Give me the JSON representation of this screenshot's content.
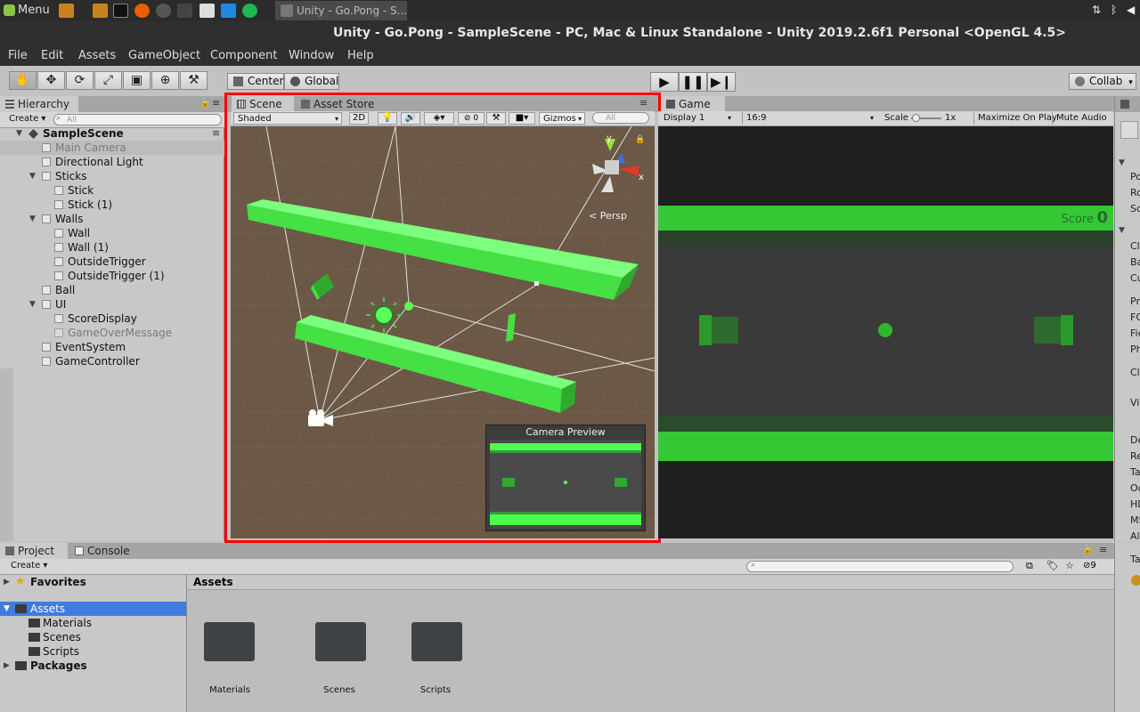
{
  "taskbar": {
    "menu_label": "Menu",
    "task_title": "Unity - Go.Pong - S..."
  },
  "window": {
    "title": "Unity - Go.Pong - SampleScene - PC, Mac & Linux Standalone - Unity 2019.2.6f1 Personal <OpenGL 4.5>"
  },
  "menubar": {
    "items": [
      "File",
      "Edit",
      "Assets",
      "GameObject",
      "Component",
      "Window",
      "Help"
    ]
  },
  "toolbar": {
    "pivot_label": "Center",
    "space_label": "Global",
    "collab_label": "Collab"
  },
  "hierarchy": {
    "tab_label": "Hierarchy",
    "create_label": "Create",
    "search_placeholder": "All",
    "scene_name": "SampleScene",
    "items": [
      {
        "label": "Main Camera"
      },
      {
        "label": "Directional Light"
      },
      {
        "label": "Sticks"
      },
      {
        "label": "Stick"
      },
      {
        "label": "Stick (1)"
      },
      {
        "label": "Walls"
      },
      {
        "label": "Wall"
      },
      {
        "label": "Wall (1)"
      },
      {
        "label": "OutsideTrigger"
      },
      {
        "label": "OutsideTrigger (1)"
      },
      {
        "label": "Ball"
      },
      {
        "label": "UI"
      },
      {
        "label": "ScoreDisplay"
      },
      {
        "label": "GameOverMessage"
      },
      {
        "label": "EventSystem"
      },
      {
        "label": "GameController"
      }
    ]
  },
  "scene": {
    "tab_label": "Scene",
    "store_tab_label": "Asset Store",
    "shading_mode": "Shaded",
    "mode_2d": "2D",
    "hidden_count": "0",
    "gizmos_label": "Gizmos",
    "search_placeholder": "All",
    "persp_label": "Persp",
    "axis_y": "y",
    "axis_x": "x",
    "camera_preview_title": "Camera Preview"
  },
  "game": {
    "tab_label": "Game",
    "display_label": "Display 1",
    "aspect_label": "16:9",
    "scale_label": "Scale",
    "scale_value": "1x",
    "maximize_label": "Maximize On Play",
    "mute_label": "Mute Audio",
    "score_label": "Score",
    "score_value": "0"
  },
  "inspector": {
    "partial_labels": [
      "Po",
      "Ro",
      "Sc",
      "Cl",
      "Ba",
      "Cu",
      "Pr",
      "FO",
      "Fie",
      "Ph",
      "Cl",
      "Vie",
      "De",
      "Re",
      "Ta",
      "Oc",
      "HD",
      "MS",
      "Al",
      "Ta"
    ]
  },
  "project": {
    "tab_label": "Project",
    "console_tab_label": "Console",
    "create_label": "Create",
    "hidden_count": "9",
    "favorites_label": "Favorites",
    "assets_label": "Assets",
    "tree": [
      {
        "label": "Materials"
      },
      {
        "label": "Scenes"
      },
      {
        "label": "Scripts"
      }
    ],
    "packages_label": "Packages",
    "breadcrumb": "Assets",
    "folders": [
      {
        "label": "Materials"
      },
      {
        "label": "Scenes"
      },
      {
        "label": "Scripts"
      }
    ]
  },
  "colors": {
    "accent_red_frame": "#ff0000",
    "object_green": "#4cff4c",
    "selection_blue": "#3e7ce0"
  }
}
